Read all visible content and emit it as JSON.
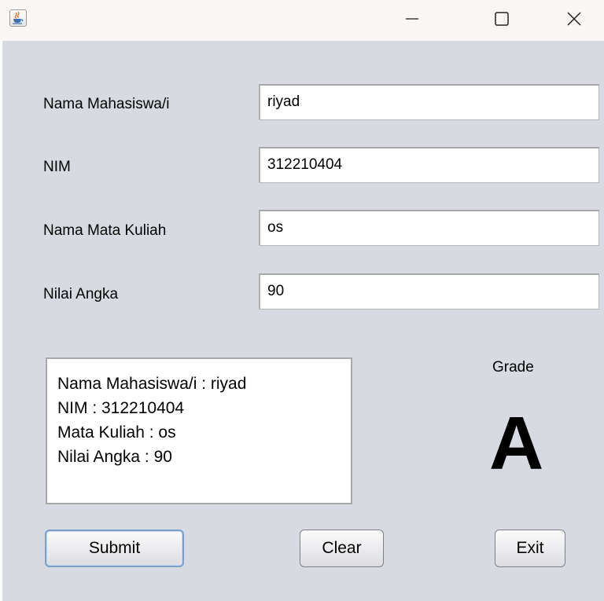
{
  "window": {
    "icon": "java-cup-icon",
    "controls": {
      "minimize": "minimize-icon",
      "maximize": "maximize-icon",
      "close": "close-icon"
    }
  },
  "form": {
    "fields": [
      {
        "label": "Nama Mahasiswa/i",
        "value": "riyad"
      },
      {
        "label": "NIM",
        "value": "312210404"
      },
      {
        "label": "Nama Mata Kuliah",
        "value": "os"
      },
      {
        "label": "Nilai Angka",
        "value": "90"
      }
    ]
  },
  "summary": {
    "lines": [
      "Nama Mahasiswa/i : riyad",
      "NIM : 312210404",
      "Mata Kuliah : os",
      "Nilai Angka : 90"
    ]
  },
  "grade": {
    "label": "Grade",
    "value": "A"
  },
  "buttons": {
    "submit": "Submit",
    "clear": "Clear",
    "exit": "Exit"
  },
  "colors": {
    "panel_background": "#d7dae1",
    "titlebar_background": "#f9f6f3",
    "focus_border": "#7aa0c9"
  }
}
